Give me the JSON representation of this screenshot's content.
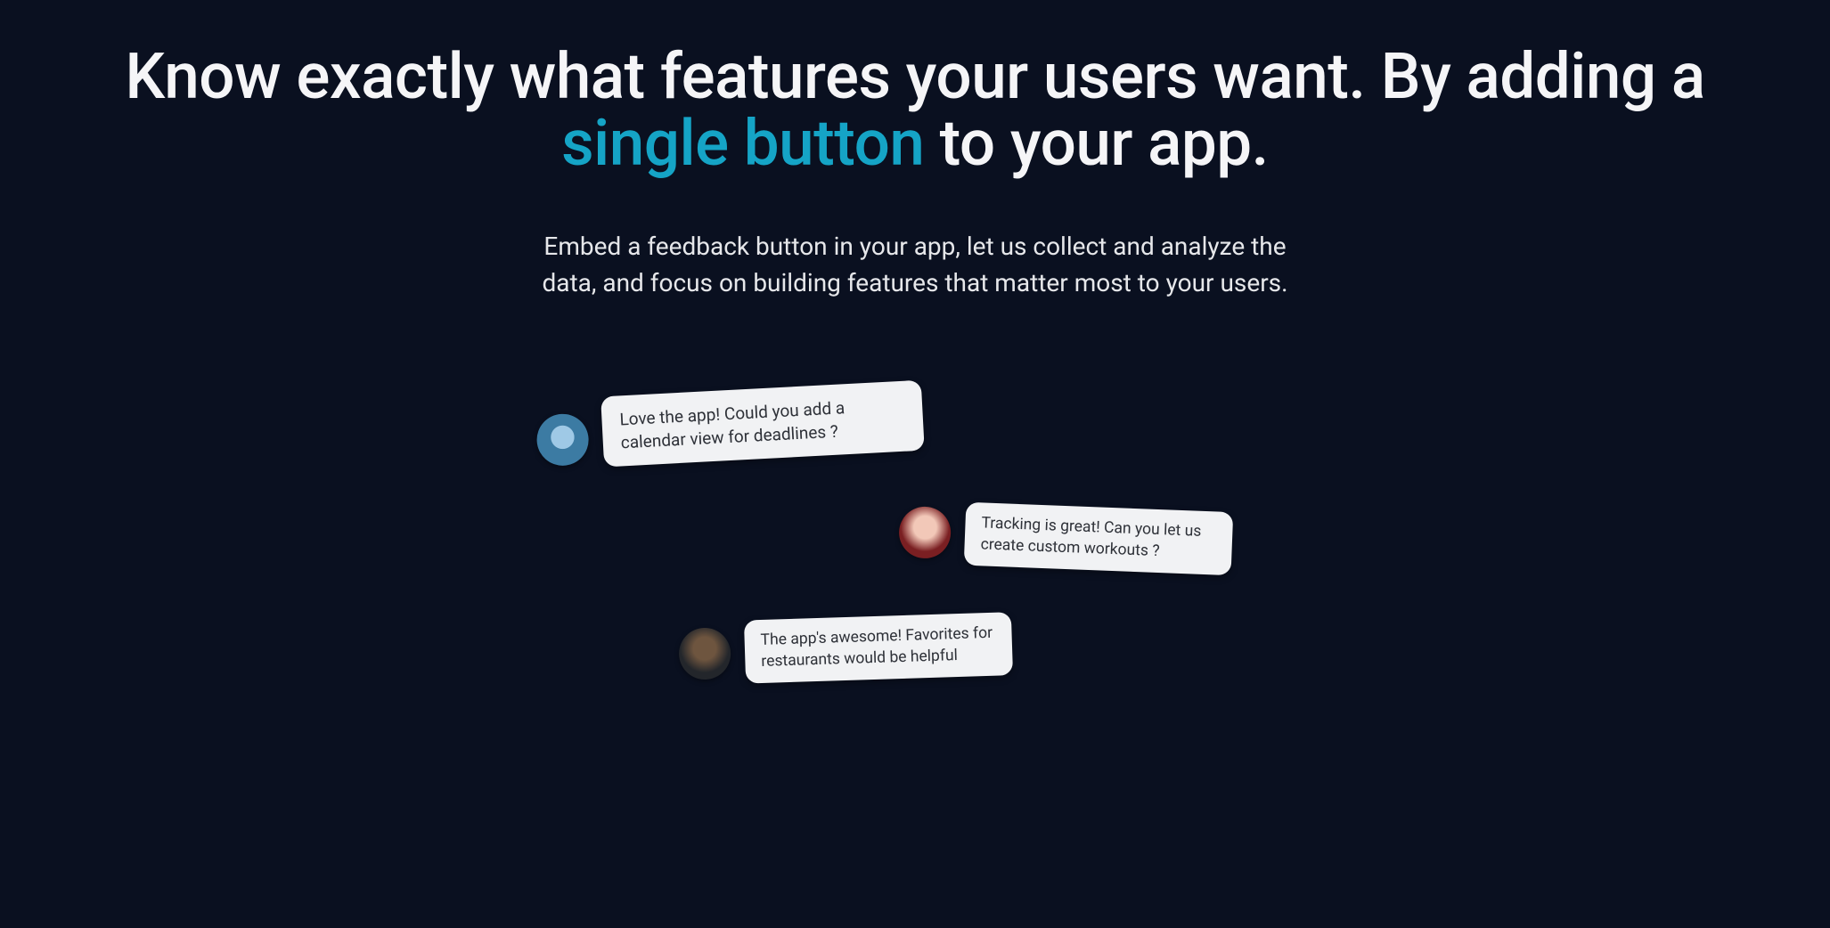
{
  "hero": {
    "headline_pre": "Know exactly what features your users want. By adding a ",
    "headline_accent": "single button",
    "headline_post": " to your app.",
    "subhead": "Embed a feedback button in your app, let us collect and analyze the data, and focus on building features that matter most to your users."
  },
  "cards": [
    {
      "avatar_label": "user-avatar-blue",
      "text": "Love the app! Could you add a calendar view for deadlines ?"
    },
    {
      "avatar_label": "user-avatar-smiling",
      "text": "Tracking is great! Can you let us create custom workouts ?"
    },
    {
      "avatar_label": "user-avatar-thoughtful",
      "text": "The app's awesome! Favorites for restaurants would be helpful"
    }
  ],
  "colors": {
    "accent": "#15a4c6",
    "background": "#0a1020"
  }
}
